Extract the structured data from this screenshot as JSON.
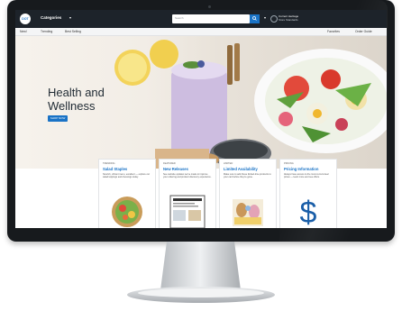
{
  "header": {
    "logo_text": "DOT",
    "categories_label": "Categories",
    "search_placeholder": "Search",
    "customer_line1": "Current Heritage",
    "customer_line2": "Store Standards"
  },
  "nav": {
    "items": [
      "New!",
      "Trending",
      "Best Selling"
    ],
    "right_items": [
      "Favorites",
      "Order Guide"
    ]
  },
  "hero": {
    "title": "Health and Wellness",
    "button_label": "SHOP NOW"
  },
  "cards": [
    {
      "tag": "TRENDING",
      "title": "Salad Staples",
      "desc": "Nourish, vibrant menu, excellent — explore our salad toppings and dressings today.",
      "image": "salad-bowl"
    },
    {
      "tag": "FEATURED",
      "title": "New Releases",
      "desc": "See website updates we've made to improve your ordering and product discovery experience.",
      "image": "document"
    },
    {
      "tag": "LIMITED",
      "title": "Limited Availability",
      "desc": "Make sure to add these limited-time products to your cart before they're gone.",
      "image": "easter-basket"
    },
    {
      "tag": "PRICING",
      "title": "Pricing Information",
      "desc": "Always have access to the most current deal prices — learn more and see offers.",
      "image": "dollar-sign"
    }
  ],
  "colors": {
    "accent": "#1a73c6",
    "topbar": "#1d232a",
    "bezel": "#171a1d"
  }
}
